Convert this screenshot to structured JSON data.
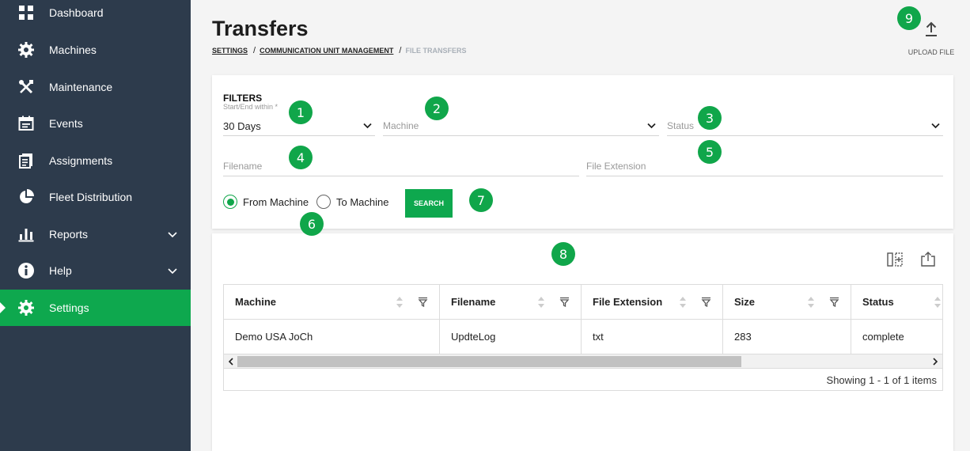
{
  "sidebar": {
    "items": [
      {
        "label": "Dashboard",
        "icon": "dashboard-icon"
      },
      {
        "label": "Machines",
        "icon": "gear-icon"
      },
      {
        "label": "Maintenance",
        "icon": "tools-icon"
      },
      {
        "label": "Events",
        "icon": "calendar-icon"
      },
      {
        "label": "Assignments",
        "icon": "clipboard-icon"
      },
      {
        "label": "Fleet Distribution",
        "icon": "pie-chart-icon"
      },
      {
        "label": "Reports",
        "icon": "bar-chart-icon"
      },
      {
        "label": "Help",
        "icon": "info-icon"
      },
      {
        "label": "Settings",
        "icon": "settings-icon"
      }
    ],
    "active": "Settings",
    "active_color": "#0ea84e",
    "background": "#2d3b4c"
  },
  "header": {
    "title": "Transfers",
    "breadcrumb": {
      "settings": "SETTINGS",
      "cu_management": "COMMUNICATION UNIT MANAGEMENT",
      "current": "FILE TRANSFERS",
      "sep": "/"
    },
    "upload_label": "UPLOAD FILE"
  },
  "badges": [
    "1",
    "2",
    "3",
    "4",
    "5",
    "6",
    "7",
    "8",
    "9"
  ],
  "filters": {
    "title": "FILTERS",
    "start_end": {
      "caption": "Start/End within *",
      "value": "30 Days"
    },
    "machine_placeholder": "Machine",
    "status_placeholder": "Status",
    "filename_placeholder": "Filename",
    "extension_placeholder": "File Extension",
    "from_machine": "From Machine",
    "to_machine": "To Machine",
    "selected_direction": "From Machine",
    "search_label": "SEARCH"
  },
  "table": {
    "columns": [
      "Machine",
      "Filename",
      "File Extension",
      "Size",
      "Status"
    ],
    "rows": [
      [
        "Demo USA JoCh",
        "UpdteLog",
        "txt",
        "283",
        "complete"
      ]
    ],
    "footer": "Showing 1 - 1 of 1 items"
  }
}
